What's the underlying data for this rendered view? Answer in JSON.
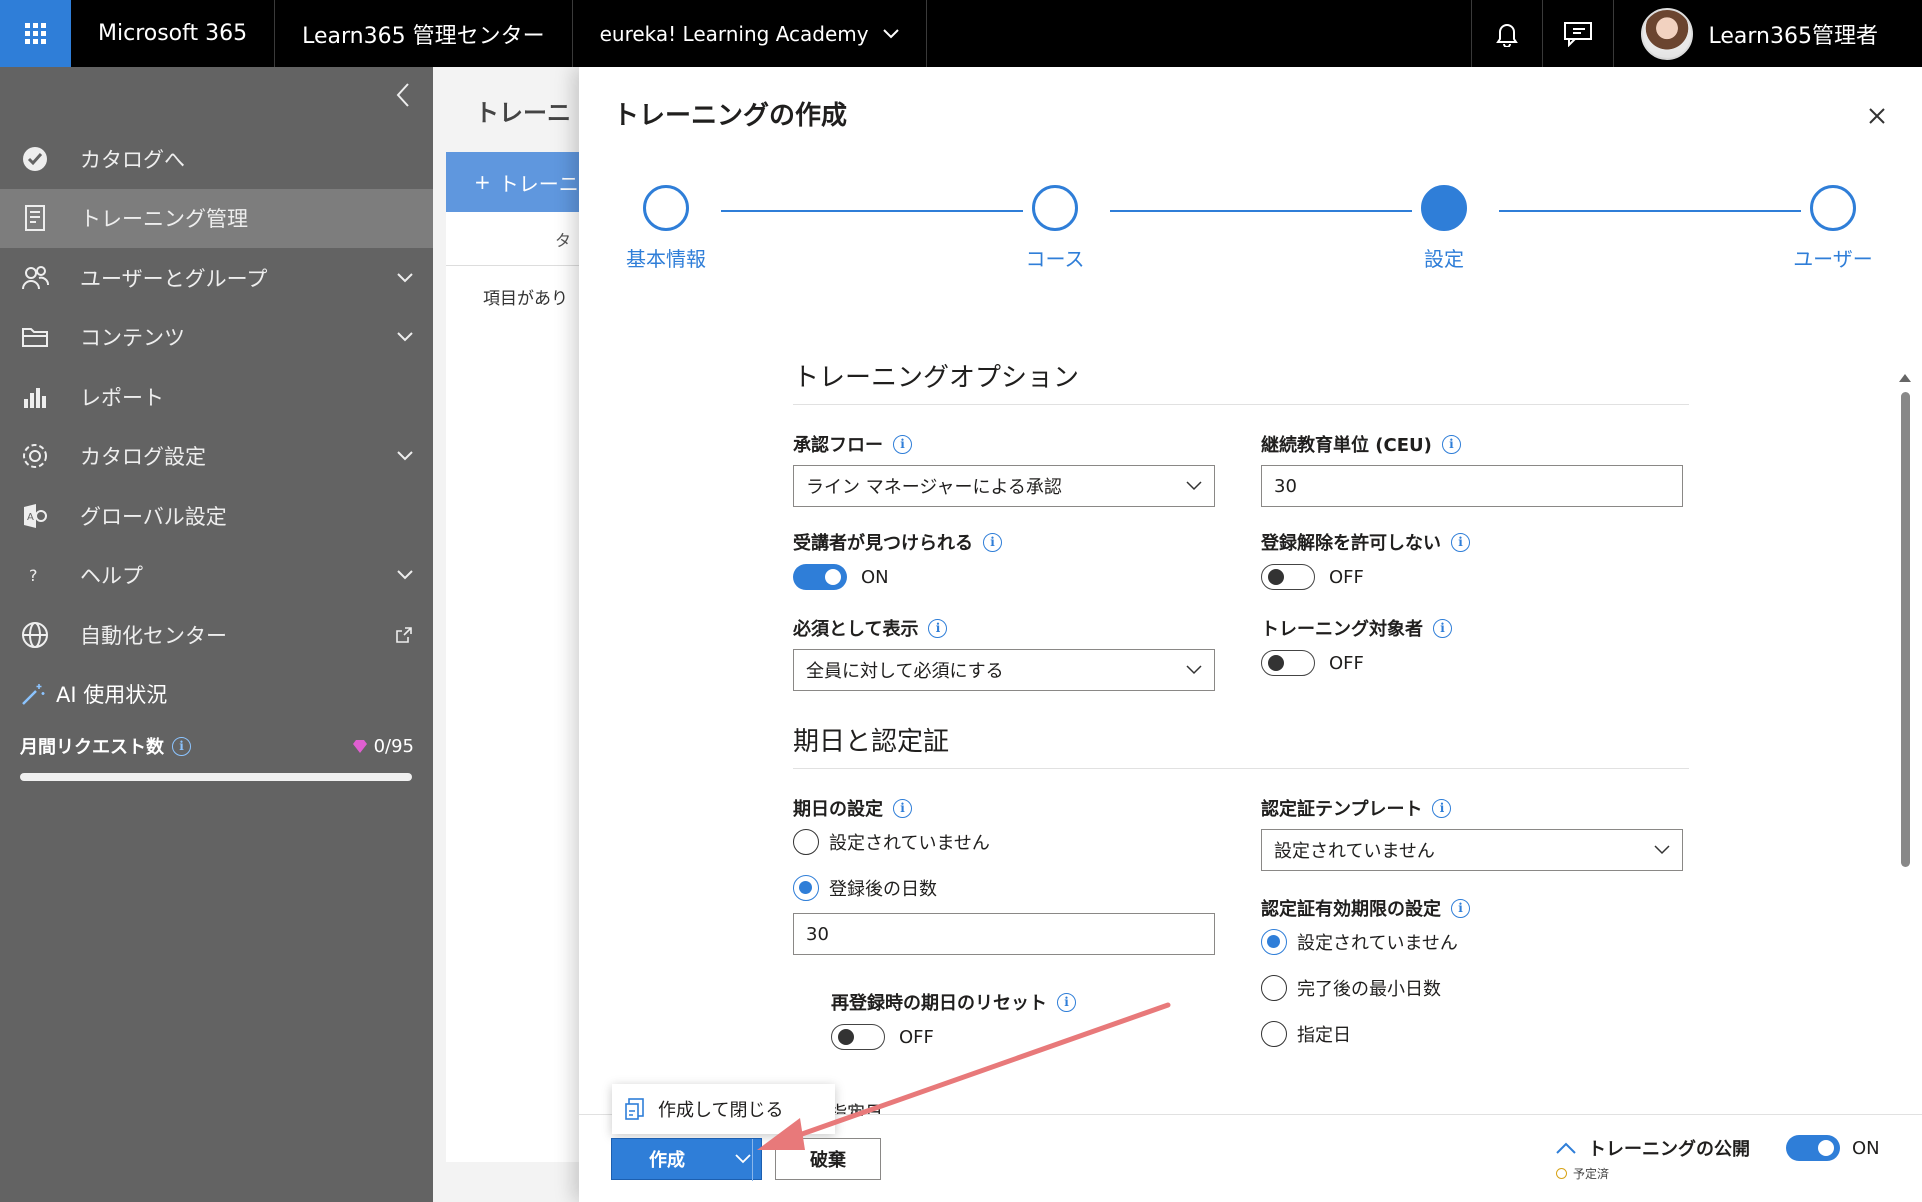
{
  "topbar": {
    "app_name": "Microsoft 365",
    "admin_center": "Learn365 管理センター",
    "tenant": "eureka! Learning Academy",
    "user_name": "Learn365管理者"
  },
  "sidebar": {
    "items": [
      {
        "label": "カタログへ",
        "icon": "catalog-check-icon"
      },
      {
        "label": "トレーニング管理",
        "icon": "document-list-icon"
      },
      {
        "label": "ユーザーとグループ",
        "icon": "people-icon"
      },
      {
        "label": "コンテンツ",
        "icon": "folder-icon"
      },
      {
        "label": "レポート",
        "icon": "bar-chart-icon"
      },
      {
        "label": "カタログ設定",
        "icon": "gear-icon"
      },
      {
        "label": "グローバル設定",
        "icon": "settings-app-icon"
      },
      {
        "label": "ヘルプ",
        "icon": "question-icon"
      },
      {
        "label": "自動化センター",
        "icon": "globe-icon"
      }
    ],
    "ai": {
      "title": "AI 使用状況",
      "requests_label": "月間リクエスト数",
      "count": "0/95",
      "usage_fraction": 0.0
    }
  },
  "background": {
    "title": "トレーニ",
    "add_button": "トレーニ",
    "column": "タ",
    "empty": "項目があり"
  },
  "panel": {
    "title": "トレーニングの作成",
    "steps": [
      "基本情報",
      "コース",
      "設定",
      "ユーザー"
    ],
    "current_step": 2,
    "section_options": "トレーニングオプション",
    "approval_flow_label": "承認フロー",
    "approval_flow_value": "ライン マネージャーによる承認",
    "ceu_label": "継続教育単位 (CEU)",
    "ceu_value": "30",
    "discoverable_label": "受講者が見つけられる",
    "discoverable_state": "ON",
    "no_unenroll_label": "登録解除を許可しない",
    "no_unenroll_state": "OFF",
    "required_label": "必須として表示",
    "required_value": "全員に対して必須にする",
    "audience_label": "トレーニング対象者",
    "audience_state": "OFF",
    "section_dates": "期日と認定証",
    "due_label": "期日の設定",
    "due_opt_none": "設定されていません",
    "due_opt_days": "登録後の日数",
    "due_days_value": "30",
    "reset_label": "再登録時の期日のリセット",
    "reset_state": "OFF",
    "due_opt_date": "指定日",
    "cert_template_label": "認定証テンプレート",
    "cert_template_value": "設定されていません",
    "cert_validity_label": "認定証有効期限の設定",
    "cert_opt_none": "設定されていません",
    "cert_opt_min_days": "完了後の最小日数",
    "cert_opt_date": "指定日"
  },
  "footer": {
    "menu_item": "作成して閉じる",
    "create": "作成",
    "discard": "破棄",
    "publish_label": "トレーニングの公開",
    "publish_state": "ON",
    "scheduled": "予定済"
  },
  "colors": {
    "accent": "#2f7ed8",
    "topbar": "#000000",
    "sidebar": "#636363",
    "annotation_arrow": "#e8797a"
  }
}
